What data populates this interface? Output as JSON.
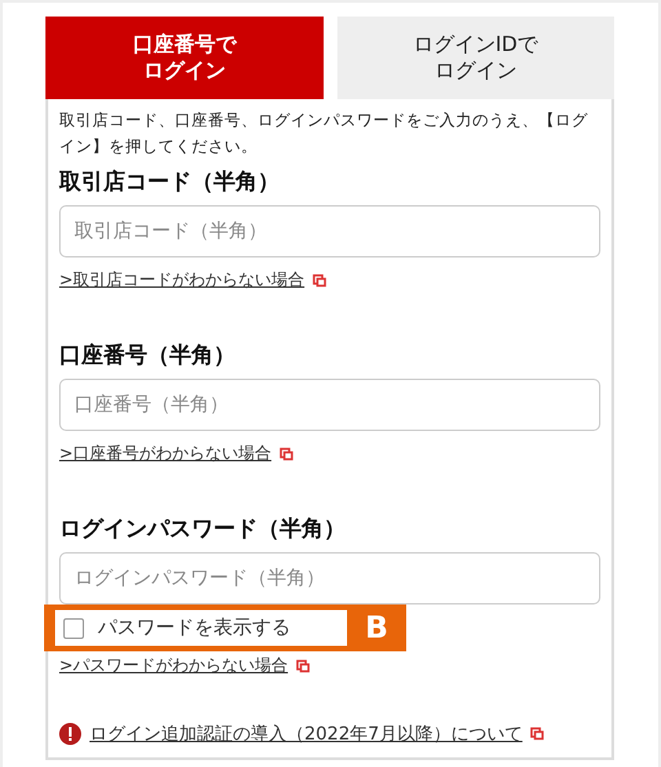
{
  "tabs": [
    {
      "label_lines": [
        "口座番号で",
        "ログイン"
      ],
      "selected": true
    },
    {
      "label_lines": [
        "ログインIDで",
        "ログイン"
      ],
      "selected": false
    }
  ],
  "intro": "取引店コード、口座番号、ログインパスワードをご入力のうえ、【ログイン】を押してください。",
  "fields": [
    {
      "label": "取引店コード（半角）",
      "placeholder": "取引店コード（半角）",
      "help_link": ">取引店コードがわからない場合"
    },
    {
      "label": "口座番号（半角）",
      "placeholder": "口座番号（半角）",
      "help_link": ">口座番号がわからない場合"
    },
    {
      "label": "ログインパスワード（半角）",
      "placeholder": "ログインパスワード（半角）",
      "help_link": ">パスワードがわからない場合"
    }
  ],
  "show_password": {
    "label": "パスワードを表示する",
    "checked": false
  },
  "callout": "B",
  "notice_link": "ログイン追加認証の導入（2022年7月以降）について"
}
